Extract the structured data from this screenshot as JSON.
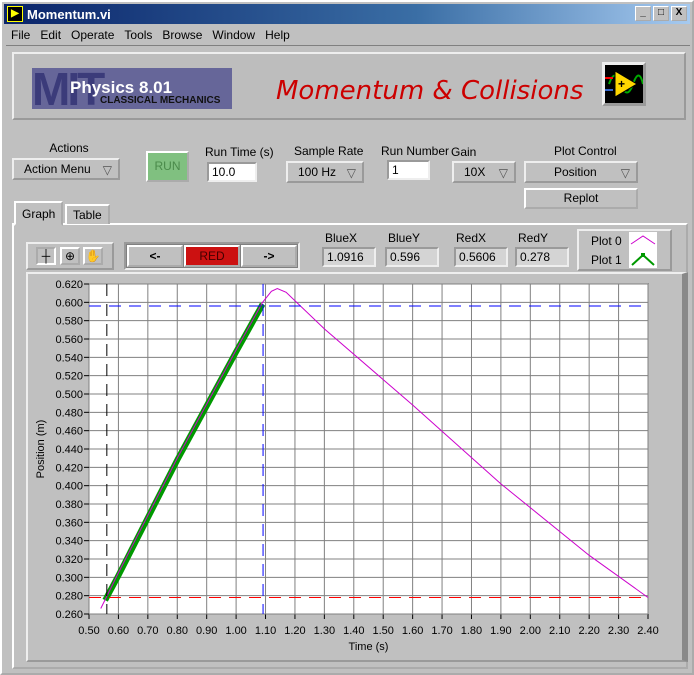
{
  "window": {
    "title": "Momentum.vi",
    "minimize": "_",
    "maximize": "□",
    "close": "X"
  },
  "menu": [
    "File",
    "Edit",
    "Operate",
    "Tools",
    "Browse",
    "Window",
    "Help"
  ],
  "banner": {
    "logo_mit": "MIT",
    "logo_course": "Physics 8.01",
    "logo_sub": "CLASSICAL MECHANICS",
    "title": "Momentum & Collisions",
    "title_color": "#cc0000"
  },
  "controls": {
    "actions": {
      "label": "Actions",
      "value": "Action Menu"
    },
    "run": {
      "label": "RUN",
      "color": "#80c080"
    },
    "run_time": {
      "label": "Run Time (s)",
      "value": "10.0"
    },
    "sample_rate": {
      "label": "Sample Rate",
      "value": "100 Hz"
    },
    "run_number": {
      "label": "Run Number",
      "value": "1"
    },
    "gain": {
      "label": "Gain",
      "value": "10X"
    },
    "plot_control": {
      "label": "Plot Control",
      "value": "Position"
    },
    "replot": "Replot"
  },
  "tabs": [
    {
      "label": "Graph",
      "active": true
    },
    {
      "label": "Table",
      "active": false
    }
  ],
  "cursor": {
    "prev": "<-",
    "active": "RED",
    "next": "->",
    "readouts": [
      {
        "label": "BlueX",
        "value": "1.0916"
      },
      {
        "label": "BlueY",
        "value": "0.596"
      },
      {
        "label": "RedX",
        "value": "0.5606"
      },
      {
        "label": "RedY",
        "value": "0.278"
      }
    ]
  },
  "legend": [
    {
      "name": "Plot 0",
      "color": "#cc00cc"
    },
    {
      "name": "Plot 1",
      "color": "#009900"
    }
  ],
  "chart_data": {
    "type": "line",
    "xlabel": "Time (s)",
    "ylabel": "Position (m)",
    "xlim": [
      0.5,
      2.4
    ],
    "ylim": [
      0.26,
      0.62
    ],
    "xticks": [
      "0.50",
      "0.60",
      "0.70",
      "0.80",
      "0.90",
      "1.00",
      "1.10",
      "1.20",
      "1.30",
      "1.40",
      "1.50",
      "1.60",
      "1.70",
      "1.80",
      "1.90",
      "2.00",
      "2.10",
      "2.20",
      "2.30",
      "2.40"
    ],
    "yticks": [
      "0.260",
      "0.280",
      "0.300",
      "0.320",
      "0.340",
      "0.360",
      "0.380",
      "0.400",
      "0.420",
      "0.440",
      "0.460",
      "0.480",
      "0.500",
      "0.520",
      "0.540",
      "0.560",
      "0.580",
      "0.600",
      "0.620"
    ],
    "grid": true,
    "series": [
      {
        "name": "Plot 0",
        "color": "#cc00cc",
        "x": [
          0.54,
          0.6,
          0.8,
          1.0,
          1.09,
          1.12,
          1.14,
          1.17,
          1.3,
          1.6,
          1.9,
          2.2,
          2.4
        ],
        "y": [
          0.266,
          0.305,
          0.43,
          0.548,
          0.6,
          0.612,
          0.615,
          0.611,
          0.571,
          0.488,
          0.402,
          0.324,
          0.278
        ]
      },
      {
        "name": "Plot 1",
        "color": "#009900",
        "x": [
          0.555,
          0.6,
          0.8,
          1.0,
          1.09
        ],
        "y": [
          0.275,
          0.302,
          0.428,
          0.546,
          0.598
        ]
      }
    ],
    "cursors": [
      {
        "name": "Blue",
        "color": "#0000ff",
        "x": 1.0916,
        "y": 0.596
      },
      {
        "name": "Red",
        "color": "#ff0000",
        "x": 0.5606,
        "y": 0.278
      }
    ]
  }
}
